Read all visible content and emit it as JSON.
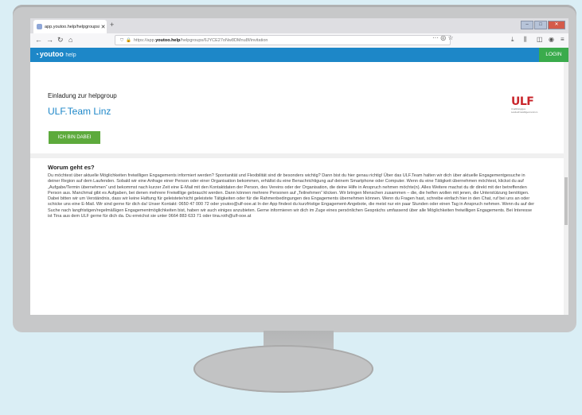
{
  "browser": {
    "tab_title": "app.youtoo.help/helpgroups/6:",
    "tab_close": "✕",
    "new_tab": "+",
    "url_prefix": "https://app.",
    "url_domain": "youtoo.help",
    "url_path": "/helpgroups/6JYCE27oNw8DMnu8f/invitation",
    "url_right_icons": "··· ◎ ☆"
  },
  "app": {
    "logo_text": "youtoo",
    "logo_help": "help",
    "login_label": "LOGIN"
  },
  "invitation": {
    "title": "Einladung zur helpgroup",
    "team_name": "ULF.Team Linz",
    "join_label": "ICH BIN DABEI",
    "org_logo_text": "ULF",
    "org_logo_sub": "Unabhängiges LandesFreiwilligenzentrum"
  },
  "section": {
    "title": "Worum geht es?",
    "description": "Du möchtest über aktuelle Möglichkeiten freiwilligen Engagements informiert werden? Spontanität und Flexibilität sind dir besonders wichtig? Dann bist du hier genau richtig! Über das ULF.Team halten wir dich über aktuelle Engagementgesuche in deiner Region auf dem Laufenden. Sobald wir eine Anfrage einer Person oder einer Organisation bekommen, erhältst du eine Benachrichtigung auf deinem Smartphone oder Computer. Wenn du eine Tätigkeit übernehmen möchtest, klickst du auf „Aufgabe/Termin übernehmen“ und bekommst nach kurzer Zeit eine E-Mail mit den Kontaktdaten der Person, des Vereins oder der Organisation, die deine Hilfe in Anspruch nehmen möchte(n). Alles Weitere machst du dir direkt mit der betreffenden Person aus. Manchmal gibt es Aufgaben, bei denen mehrere Freiwillige gebraucht werden. Dann können mehrere Personen auf „Teilnehmen“ klicken. Wir bringen Menschen zusammen – die, die helfen wollen mit jenen, die Unterstützung benötigen. Dabei bitten wir um Verständnis, dass wir keine Haftung für geleistete/nicht geleistete Tätigkeiten oder für die Rahmenbedingungen des Engagements übernehmen können. Wenn du Fragen hast, schreibe einfach hier in den Chat, ruf bei uns an oder schicke uns eine E-Mail. Wir sind gerne für dich da! Unser Kontakt: 0650 47 000 72 oder youtoo@ulf-ooe.at In der App findest du kurzfristige Engagement-Angebote, die meist nur ein paar Stunden oder einen Tag in Anspruch nehmen. Wenn du auf der Suche nach langfristigen/regelmäßigen Engagementmöglichkeiten bist, haben wir auch einiges anzubieten. Gerne informieren wir dich im Zuge eines persönlichen Gesprächs umfassend über alle Möglichkeiten freiwilligen Engagements. Bei Interesse ist Tina aus dem ULF gerne für dich da. Du erreichst sie unter 0664 883 633 71 oder tina.roth@ulf-ooe.at"
  },
  "colors": {
    "app_bar": "#1d87c8",
    "login_button": "#3aab4c",
    "join_button": "#5daa3c",
    "accent_text": "#1d87c8",
    "org_red": "#c9262c"
  }
}
